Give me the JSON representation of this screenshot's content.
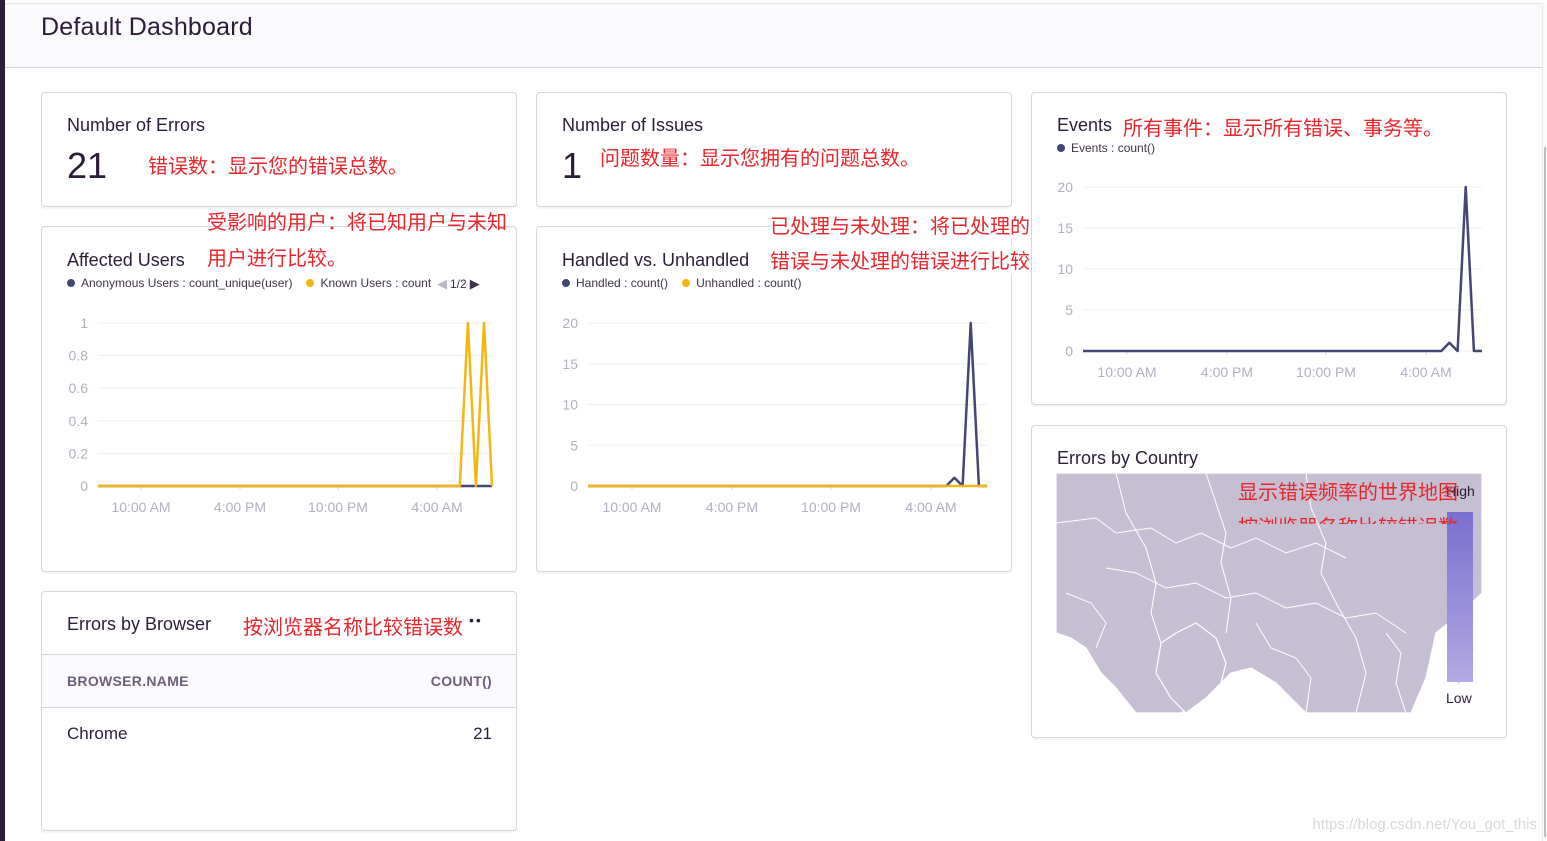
{
  "header": {
    "title": "Default Dashboard"
  },
  "cards": {
    "errors": {
      "title": "Number of Errors",
      "value": "21",
      "annotation": "错误数：显示您的错误总数。"
    },
    "issues": {
      "title": "Number of Issues",
      "value": "1",
      "annotation": "问题数量：显示您拥有的问题总数。"
    },
    "events": {
      "title": "Events",
      "annotation": "所有事件：显示所有错误、事务等。",
      "legend": [
        {
          "label": "Events : count()",
          "color": "#444674"
        }
      ]
    },
    "affected": {
      "title": "Affected Users",
      "annotation_line1": "受影响的用户：将已知用户与未知",
      "annotation_line2": "用户进行比较。",
      "legend": [
        {
          "label": "Anonymous Users : count_unique(user)",
          "color": "#444674"
        },
        {
          "label": "Known Users : count",
          "color": "#f2b712"
        }
      ],
      "legend_page": "1/2"
    },
    "handled": {
      "title": "Handled vs. Unhandled",
      "annotation_line1": "已处理与未处理：将已处理的",
      "annotation_line2": "错误与未处理的错误进行比较",
      "legend": [
        {
          "label": "Handled : count()",
          "color": "#444674"
        },
        {
          "label": "Unhandled : count()",
          "color": "#f2b712"
        }
      ]
    },
    "browser": {
      "title": "Errors by Browser",
      "annotation": "按浏览器名称比较错误数",
      "menu_glyph": "••",
      "columns": [
        "BROWSER.NAME",
        "COUNT()"
      ],
      "rows": [
        {
          "name": "Chrome",
          "count": "21"
        }
      ]
    },
    "country": {
      "title": "Errors by Country",
      "annotation_line1": "显示错误频率的世界地图",
      "annotation_line2": "按浏览器名称比较错误数",
      "scale_high": "High",
      "scale_low": "Low"
    }
  },
  "chart_data": [
    {
      "type": "line",
      "title": "Affected Users",
      "x_ticks": [
        "10:00 AM",
        "4:00 PM",
        "10:00 PM",
        "4:00 AM"
      ],
      "y_ticks": [
        "0",
        "0.2",
        "0.4",
        "0.6",
        "0.8",
        "1"
      ],
      "ylim": [
        0,
        1
      ],
      "series": [
        {
          "name": "Anonymous Users : count_unique(user)",
          "color": "#444674",
          "values": [
            0,
            0,
            0,
            0,
            0,
            0,
            0,
            0,
            0,
            0,
            0,
            0,
            0,
            0,
            0,
            0,
            0,
            0,
            0,
            0,
            0,
            0,
            0,
            0,
            0,
            0,
            0,
            0,
            0,
            0,
            0,
            0,
            0,
            0,
            0,
            0,
            0,
            0,
            0,
            0,
            0,
            0,
            0,
            0,
            0,
            0,
            0,
            0,
            0,
            0
          ]
        },
        {
          "name": "Known Users : count",
          "color": "#f2b712",
          "values": [
            0,
            0,
            0,
            0,
            0,
            0,
            0,
            0,
            0,
            0,
            0,
            0,
            0,
            0,
            0,
            0,
            0,
            0,
            0,
            0,
            0,
            0,
            0,
            0,
            0,
            0,
            0,
            0,
            0,
            0,
            0,
            0,
            0,
            0,
            0,
            0,
            0,
            0,
            0,
            0,
            0,
            0,
            0,
            0,
            0,
            0,
            1,
            0,
            1,
            0
          ]
        }
      ]
    },
    {
      "type": "line",
      "title": "Handled vs. Unhandled",
      "x_ticks": [
        "10:00 AM",
        "4:00 PM",
        "10:00 PM",
        "4:00 AM"
      ],
      "y_ticks": [
        "0",
        "5",
        "10",
        "15",
        "20"
      ],
      "ylim": [
        0,
        20
      ],
      "series": [
        {
          "name": "Handled : count()",
          "color": "#444674",
          "values": [
            0,
            0,
            0,
            0,
            0,
            0,
            0,
            0,
            0,
            0,
            0,
            0,
            0,
            0,
            0,
            0,
            0,
            0,
            0,
            0,
            0,
            0,
            0,
            0,
            0,
            0,
            0,
            0,
            0,
            0,
            0,
            0,
            0,
            0,
            0,
            0,
            0,
            0,
            0,
            0,
            0,
            0,
            0,
            0,
            0,
            1,
            0,
            20,
            0,
            0
          ]
        },
        {
          "name": "Unhandled : count()",
          "color": "#f2b712",
          "values": [
            0,
            0,
            0,
            0,
            0,
            0,
            0,
            0,
            0,
            0,
            0,
            0,
            0,
            0,
            0,
            0,
            0,
            0,
            0,
            0,
            0,
            0,
            0,
            0,
            0,
            0,
            0,
            0,
            0,
            0,
            0,
            0,
            0,
            0,
            0,
            0,
            0,
            0,
            0,
            0,
            0,
            0,
            0,
            0,
            0,
            0,
            0,
            0,
            0,
            0
          ]
        }
      ]
    },
    {
      "type": "line",
      "title": "Events",
      "x_ticks": [
        "10:00 AM",
        "4:00 PM",
        "10:00 PM",
        "4:00 AM"
      ],
      "y_ticks": [
        "0",
        "5",
        "10",
        "15",
        "20"
      ],
      "ylim": [
        0,
        20
      ],
      "series": [
        {
          "name": "Events : count()",
          "color": "#444674",
          "values": [
            0,
            0,
            0,
            0,
            0,
            0,
            0,
            0,
            0,
            0,
            0,
            0,
            0,
            0,
            0,
            0,
            0,
            0,
            0,
            0,
            0,
            0,
            0,
            0,
            0,
            0,
            0,
            0,
            0,
            0,
            0,
            0,
            0,
            0,
            0,
            0,
            0,
            0,
            0,
            0,
            0,
            0,
            0,
            0,
            0,
            1,
            0,
            20,
            0,
            0
          ]
        }
      ]
    }
  ],
  "watermark": "https://blog.csdn.net/You_got_this"
}
